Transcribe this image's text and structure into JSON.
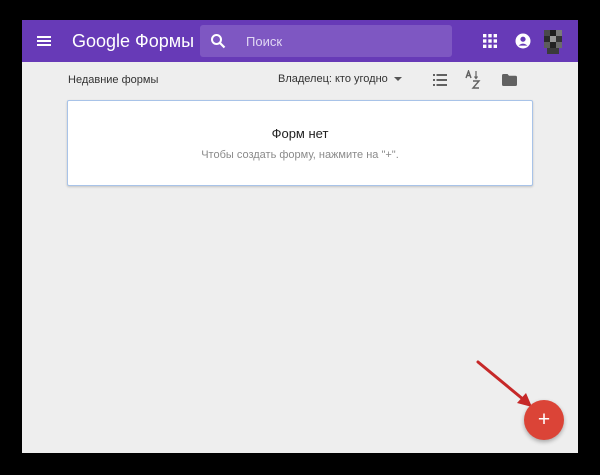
{
  "header": {
    "brand": "Google Формы",
    "search_placeholder": "Поиск",
    "icons": [
      "menu-icon",
      "search-icon",
      "apps-icon",
      "account-icon"
    ]
  },
  "toolbar": {
    "section_title": "Недавние формы",
    "owner_filter": "Владелец: кто угодно",
    "icons": [
      "list-view-icon",
      "sort-az-icon",
      "folder-icon"
    ]
  },
  "empty_state": {
    "title": "Форм нет",
    "hint": "Чтобы создать форму, нажмите на \"+\"."
  },
  "fab": {
    "label": "+"
  },
  "colors": {
    "appbar": "#673ab7",
    "search_box": "#7e57c2",
    "background": "#eeeeee",
    "fab": "#db4437",
    "annotation_arrow": "#c62828"
  }
}
